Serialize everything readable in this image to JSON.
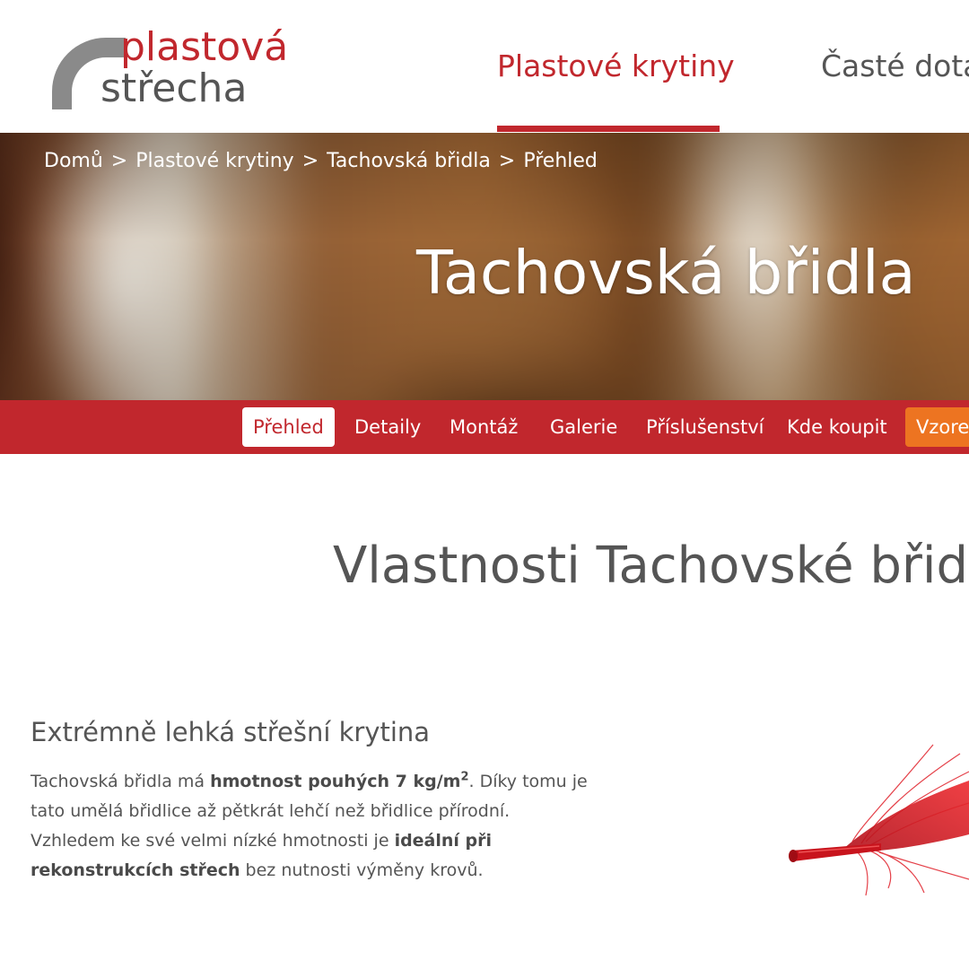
{
  "logo": {
    "line1": "plastová",
    "line2": "střecha"
  },
  "main_nav": {
    "items": [
      {
        "label": "Plastové krytiny",
        "active": true
      },
      {
        "label": "Časté dotazy",
        "active": false
      }
    ]
  },
  "breadcrumb": {
    "items": [
      "Domů",
      "Plastové krytiny",
      "Tachovská břidla"
    ],
    "current": "Přehled",
    "separator": ">"
  },
  "hero": {
    "title": "Tachovská břidla"
  },
  "sub_nav": {
    "items": [
      {
        "label": "Přehled",
        "state": "active"
      },
      {
        "label": "Detaily",
        "state": "normal"
      },
      {
        "label": "Montáž",
        "state": "normal"
      },
      {
        "label": "Galerie",
        "state": "normal"
      },
      {
        "label": "Příslušenství",
        "state": "normal"
      },
      {
        "label": "Kde koupit",
        "state": "normal"
      },
      {
        "label": "Vzorek zdarma",
        "state": "cta"
      }
    ]
  },
  "content": {
    "section_title": "Vlastnosti Tachovské břidly",
    "feature": {
      "heading": "Extrémně lehká střešní krytina",
      "text_1": "Tachovská břidla má ",
      "text_1_bold": "hmotnost pouhých 7 kg/m",
      "text_1_sup": "2",
      "text_1_end": ". Díky tomu je",
      "text_2": "tato umělá břidlice až pětkrát lehčí než břidlice přírodní.",
      "text_3": "Vzhledem ke své velmi nízké hmotnosti je ",
      "text_3_bold": "ideální při",
      "text_4_bold": "rekonstrukcích střech",
      "text_4": " bez nutnosti výměny krovů."
    },
    "image_icon": "red-feather-icon"
  },
  "colors": {
    "brand_red": "#c1272d",
    "cta_orange": "#ed7421",
    "text_gray": "#555555",
    "logo_gray": "#8a8a8a"
  }
}
